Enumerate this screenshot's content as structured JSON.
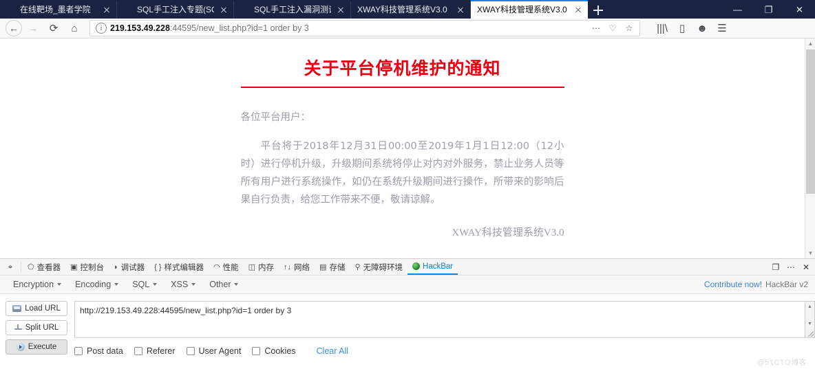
{
  "window": {
    "minimize_label": "—",
    "maximize_label": "❐",
    "close_label": "✕",
    "newtab_label": "+"
  },
  "tabs": [
    {
      "title": "在线靶场_墨者学院",
      "favicon": "firefox-favicon",
      "active": false
    },
    {
      "title": "SQL手工注入专题(SQL Injectio",
      "favicon": "firefox-favicon",
      "active": false
    },
    {
      "title": "SQL手工注入漏洞测试(MySQL",
      "favicon": "firefox-favicon",
      "active": false
    },
    {
      "title": "XWAY科技管理系统V3.0",
      "favicon": "none",
      "active": false
    },
    {
      "title": "XWAY科技管理系统V3.0",
      "favicon": "none",
      "active": true
    }
  ],
  "nav": {
    "back_icon": "back-arrow-icon",
    "forward_icon": "forward-arrow-icon",
    "reload_icon": "reload-icon",
    "home_icon": "home-icon",
    "back_glyph": "←",
    "forward_glyph": "→",
    "reload_glyph": "⟳",
    "home_glyph": "⌂"
  },
  "urlbar": {
    "info_glyph": "i",
    "host": "219.153.49.228",
    "path": ":44595/new_list.php?id=1 order by 3",
    "full_url": "219.153.49.228:44595/new_list.php?id=1 order by 3",
    "page_actions_glyph": "⋯",
    "pocket_glyph": "♡",
    "bookmark_glyph": "☆"
  },
  "toolbar_right": {
    "library_glyph": "|||\\",
    "sidebar_glyph": "▯",
    "account_glyph": "☻",
    "menu_glyph": "☰"
  },
  "page": {
    "title": "关于平台停机维护的通知",
    "greeting": "各位平台用户：",
    "body": "平台将于2018年12月31日00:00至2019年1月1日12:00（12小时）进行停机升级，升级期间系统将停止对内对外服务，禁止业务人员等所有用户进行系统操作，如仍在系统升级期间进行操作，所带来的影响后果自行负责，给您工作带来不便，敬请谅解。",
    "signature": "XWAY科技管理系统V3.0",
    "title_color": "#e60012",
    "body_color": "#9aa0a8"
  },
  "devtools": {
    "picker_glyph": "⌖",
    "tabs": [
      {
        "label": "查看器",
        "icon": "inspector-icon",
        "glyph": "⬠",
        "active": false
      },
      {
        "label": "控制台",
        "icon": "console-icon",
        "glyph": "▣",
        "active": false
      },
      {
        "label": "调试器",
        "icon": "debugger-icon",
        "glyph": "◗",
        "active": false
      },
      {
        "label": "样式编辑器",
        "icon": "style-editor-icon",
        "glyph": "{ }",
        "active": false
      },
      {
        "label": "性能",
        "icon": "performance-icon",
        "glyph": "◠",
        "active": false
      },
      {
        "label": "内存",
        "icon": "memory-icon",
        "glyph": "◫",
        "active": false
      },
      {
        "label": "网络",
        "icon": "network-icon",
        "glyph": "↑↓",
        "active": false
      },
      {
        "label": "存储",
        "icon": "storage-icon",
        "glyph": "▤",
        "active": false
      },
      {
        "label": "无障碍环境",
        "icon": "accessibility-icon",
        "glyph": "⚲",
        "active": false
      },
      {
        "label": "HackBar",
        "icon": "hackbar-icon",
        "glyph": "",
        "active": true
      }
    ],
    "responsive_glyph": "❐",
    "more_glyph": "⋯",
    "close_glyph": "✕"
  },
  "hackbar": {
    "menus": [
      {
        "label": "Encryption"
      },
      {
        "label": "Encoding"
      },
      {
        "label": "SQL"
      },
      {
        "label": "XSS"
      },
      {
        "label": "Other"
      }
    ],
    "contribute_label": "Contribute now!",
    "version_label": "HackBar v2",
    "buttons": [
      {
        "label": "Load URL",
        "icon": "load-url-icon",
        "pressed": false
      },
      {
        "label": "Split URL",
        "icon": "split-url-icon",
        "pressed": false
      },
      {
        "label": "Execute",
        "icon": "execute-icon",
        "pressed": true
      }
    ],
    "url_value": "http://219.153.49.228:44595/new_list.php?id=1 order by 3",
    "url_placeholder": "",
    "options": [
      {
        "label": "Post data",
        "checked": false
      },
      {
        "label": "Referer",
        "checked": false
      },
      {
        "label": "User Agent",
        "checked": false
      },
      {
        "label": "Cookies",
        "checked": false
      }
    ],
    "clear_all_label": "Clear All",
    "link_color": "#3b8ee0"
  },
  "watermark": "@51CTO博客"
}
